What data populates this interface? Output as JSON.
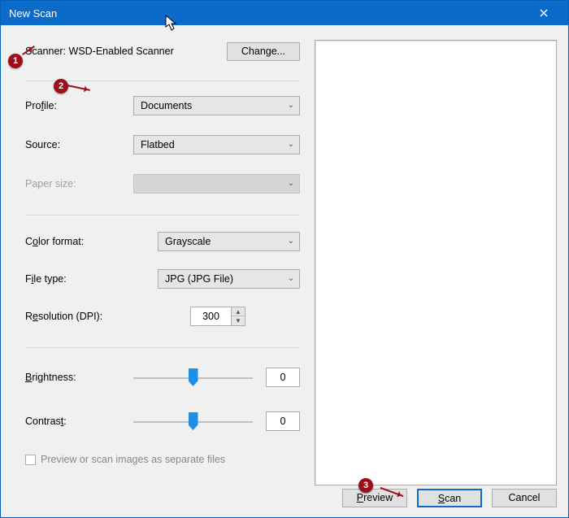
{
  "window": {
    "title": "New Scan"
  },
  "scanner": {
    "label_prefix": "Scanner: ",
    "name": "WSD-Enabled Scanner",
    "change_button": "Change..."
  },
  "profile": {
    "label_pre": "Pro",
    "label_acc": "f",
    "label_post": "ile:",
    "value": "Documents"
  },
  "source": {
    "label": "Source:",
    "value": "Flatbed"
  },
  "paper_size": {
    "label": "Paper size:",
    "value": ""
  },
  "color_format": {
    "label_pre": "C",
    "label_acc": "o",
    "label_post": "lor format:",
    "value": "Grayscale"
  },
  "file_type": {
    "label_pre": "F",
    "label_acc": "i",
    "label_post": "le type:",
    "value": "JPG (JPG File)"
  },
  "resolution": {
    "label_pre": "R",
    "label_acc": "e",
    "label_post": "solution (DPI):",
    "value": "300"
  },
  "brightness": {
    "label_acc": "B",
    "label_post": "rightness:",
    "value": "0"
  },
  "contrast": {
    "label_pre": "Contras",
    "label_acc": "t",
    "label_post": ":",
    "value": "0"
  },
  "separate_files": {
    "label": "Preview or scan images as separate files"
  },
  "footer": {
    "preview_pre": "",
    "preview_acc": "P",
    "preview_post": "review",
    "scan_pre": "",
    "scan_acc": "S",
    "scan_post": "can",
    "cancel": "Cancel"
  },
  "callouts": {
    "c1": "1",
    "c2": "2",
    "c3": "3"
  }
}
